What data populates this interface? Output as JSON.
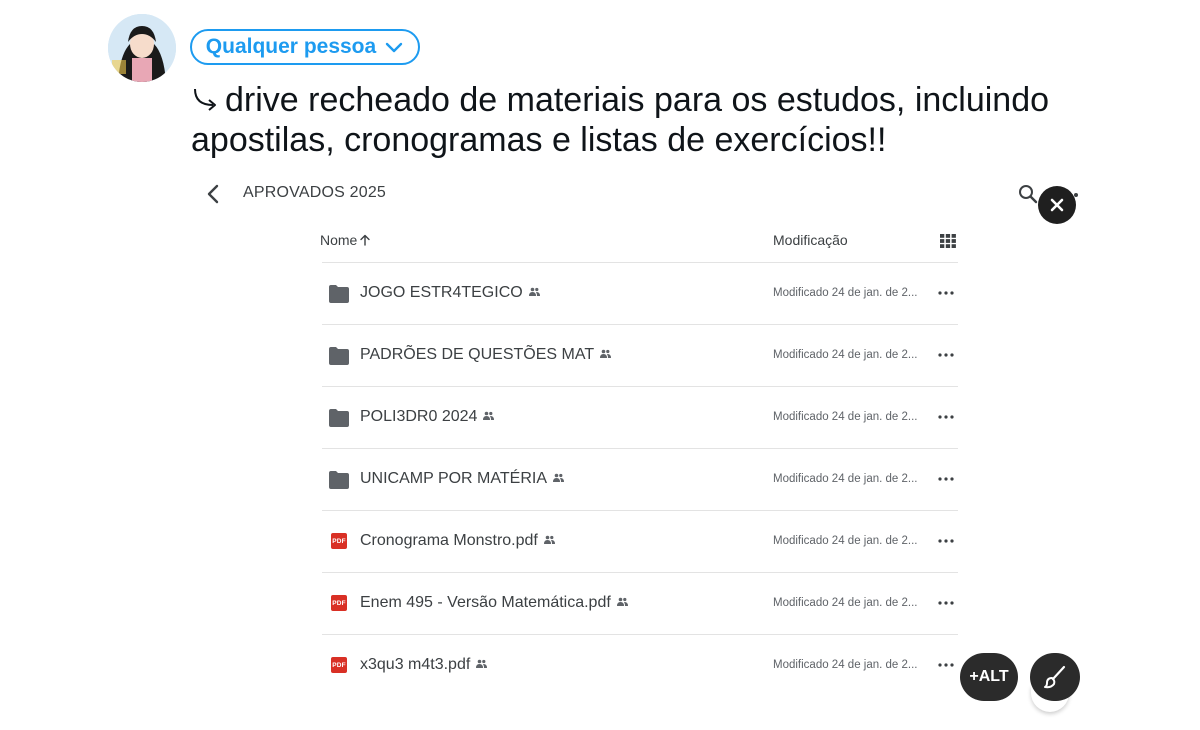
{
  "audience": {
    "label": "Qualquer pessoa"
  },
  "compose": {
    "text_line1": "drive recheado de materiais para os estudos, incluindo",
    "text_line2": "apostilas, cronogramas e listas de exercícios!!"
  },
  "drive": {
    "title": "APROVADOS 2025",
    "columns": {
      "name": "Nome",
      "modified": "Modificação"
    },
    "items": [
      {
        "name": "JOGO ESTR4TEGICO",
        "type": "folder",
        "modified": "Modificado 24 de jan. de 2..."
      },
      {
        "name": "PADRÕES DE QUESTÕES MAT",
        "type": "folder",
        "modified": "Modificado 24 de jan. de 2..."
      },
      {
        "name": "POLI3DR0 2024",
        "type": "folder",
        "modified": "Modificado 24 de jan. de 2..."
      },
      {
        "name": "UNICAMP POR MATÉRIA",
        "type": "folder",
        "modified": "Modificado 24 de jan. de 2..."
      },
      {
        "name": "Cronograma Monstro.pdf",
        "type": "pdf",
        "modified": "Modificado 24 de jan. de 2..."
      },
      {
        "name": "Enem 495 - Versão Matemática.pdf",
        "type": "pdf",
        "modified": "Modificado 24 de jan. de 2..."
      },
      {
        "name": "x3qu3 m4t3.pdf",
        "type": "pdf",
        "modified": "Modificado 24 de jan. de 2..."
      }
    ],
    "pdf_badge": "PDF"
  },
  "actions": {
    "alt_label": "+ALT"
  },
  "colors": {
    "accent": "#1d9bf0",
    "pdf": "#d93025",
    "dark_button": "#2b2b2b"
  }
}
